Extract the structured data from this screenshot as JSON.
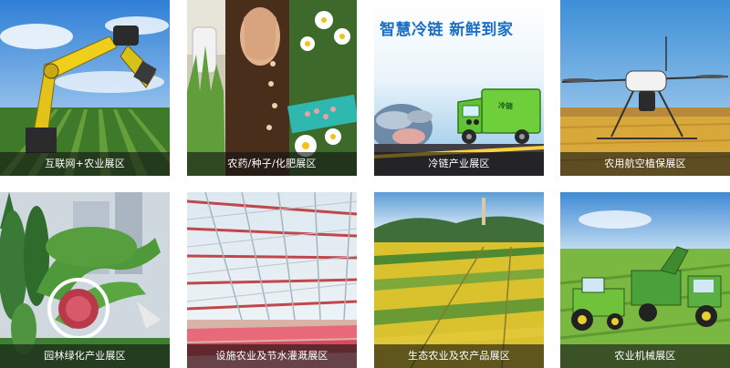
{
  "tiles": [
    {
      "label": "互联网+农业展区"
    },
    {
      "label": "农药/种子/化肥展区"
    },
    {
      "label": "冷链产业展区",
      "banner_text": "智慧冷链  新鲜到家",
      "truck_text": "冷链"
    },
    {
      "label": "农用航空植保展区"
    },
    {
      "label": "园林绿化产业展区"
    },
    {
      "label": "设施农业及节水灌溉展区"
    },
    {
      "label": "生态农业及农产品展区"
    },
    {
      "label": "农业机械展区"
    }
  ],
  "colors": {
    "caption_bg": "#141414",
    "caption_text": "#ffffff",
    "cold_chain_title": "#1a6fc4"
  }
}
